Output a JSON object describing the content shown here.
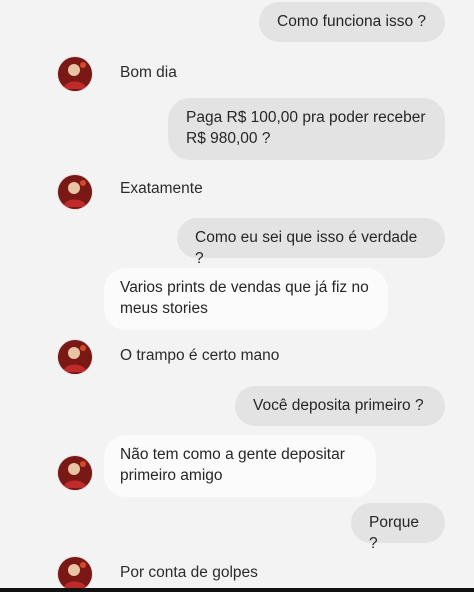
{
  "messages": [
    {
      "side": "out",
      "text": "Como funciona isso ?"
    },
    {
      "side": "in",
      "text": "Bom dia"
    },
    {
      "side": "out",
      "text": "Paga R$ 100,00 pra poder receber\nR$ 980,00 ?"
    },
    {
      "side": "in",
      "text": "Exatamente"
    },
    {
      "side": "out",
      "text": "Como eu sei que isso é verdade ?"
    },
    {
      "side": "in",
      "text": "Varios prints de vendas que já fiz no\nmeus stories"
    },
    {
      "side": "in",
      "text": "O trampo é certo mano"
    },
    {
      "side": "out",
      "text": "Você deposita primeiro ?"
    },
    {
      "side": "in",
      "text": "Não tem como a gente depositar\nprimeiro amigo"
    },
    {
      "side": "out",
      "text": "Porque ?"
    },
    {
      "side": "in",
      "text": "Por conta de golpes"
    }
  ],
  "colors": {
    "background": "#f3f3f3",
    "outgoing_bubble": "#e3e3e3",
    "incoming_bubble": "#fbfbfb",
    "text": "#262626"
  },
  "icons": {
    "avatar": "profile-avatar"
  }
}
